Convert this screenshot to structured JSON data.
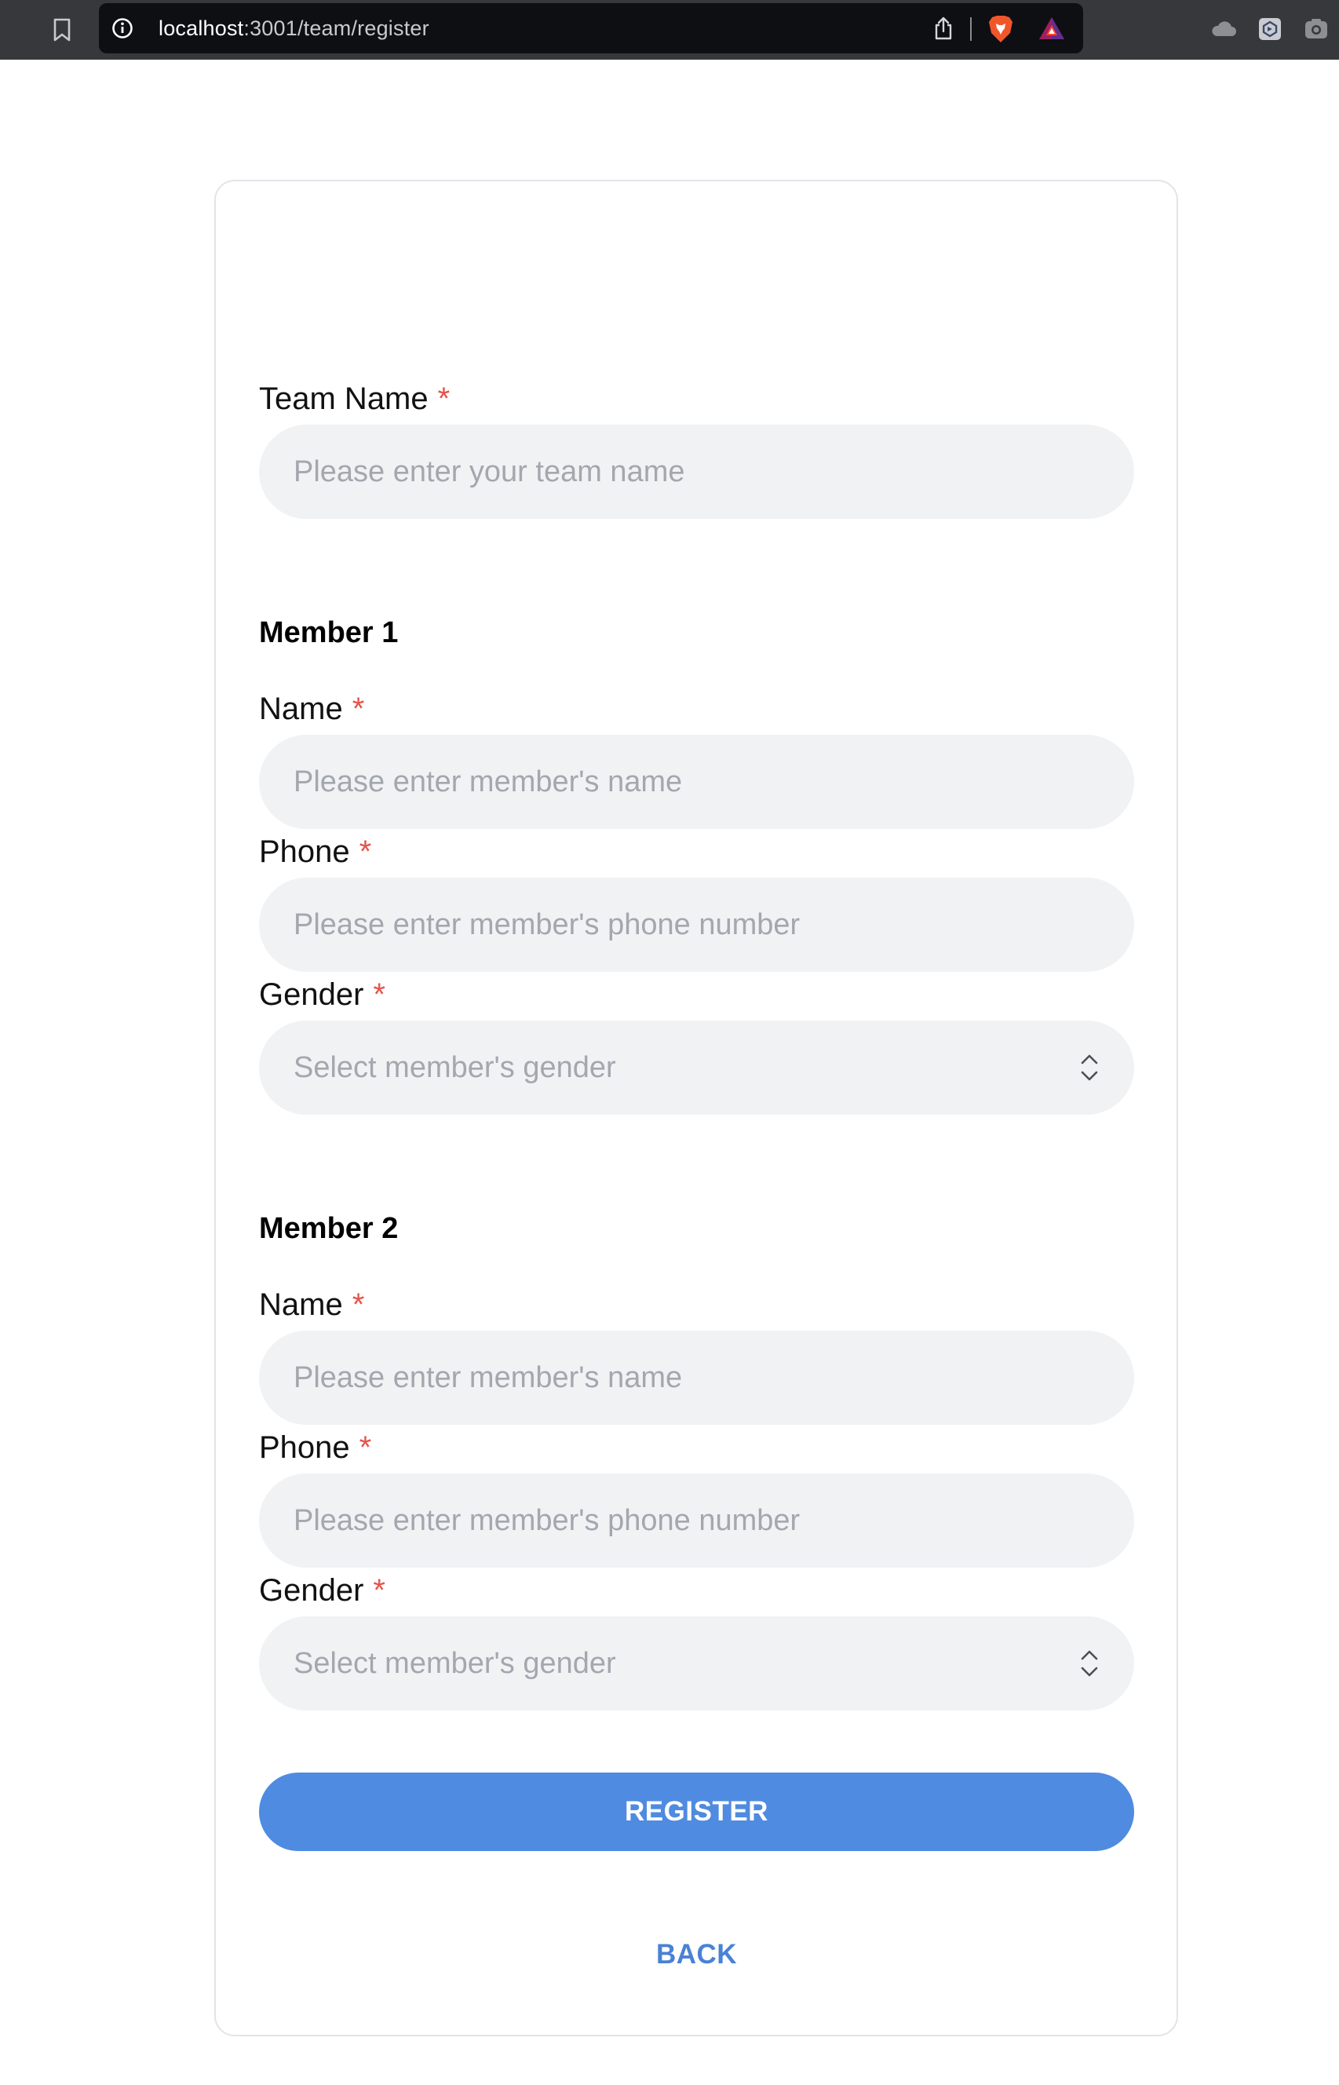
{
  "browser": {
    "url_host": "localhost",
    "url_path": ":3001/team/register"
  },
  "form": {
    "team_name": {
      "label": "Team Name",
      "required_mark": "*",
      "placeholder": "Please enter your team name",
      "value": ""
    },
    "members": [
      {
        "title": "Member 1",
        "name": {
          "label": "Name",
          "required_mark": "*",
          "placeholder": "Please enter member's name",
          "value": ""
        },
        "phone": {
          "label": "Phone",
          "required_mark": "*",
          "placeholder": "Please enter member's phone number",
          "value": ""
        },
        "gender": {
          "label": "Gender",
          "required_mark": "*",
          "placeholder": "Select member's gender"
        }
      },
      {
        "title": "Member 2",
        "name": {
          "label": "Name",
          "required_mark": "*",
          "placeholder": "Please enter member's name",
          "value": ""
        },
        "phone": {
          "label": "Phone",
          "required_mark": "*",
          "placeholder": "Please enter member's phone number",
          "value": ""
        },
        "gender": {
          "label": "Gender",
          "required_mark": "*",
          "placeholder": "Select member's gender"
        }
      }
    ],
    "register_label": "REGISTER",
    "back_label": "BACK"
  },
  "colors": {
    "accent": "#4f8be0",
    "required": "#e5534b",
    "field_bg": "#f1f2f4",
    "placeholder": "#a3a7ae"
  },
  "icons": [
    "bookmark-icon",
    "info-icon",
    "share-icon",
    "brave-lion-icon",
    "bat-triangle-icon",
    "cloud-icon",
    "extension-icon",
    "camera-icon",
    "chevrons-updown-icon"
  ]
}
